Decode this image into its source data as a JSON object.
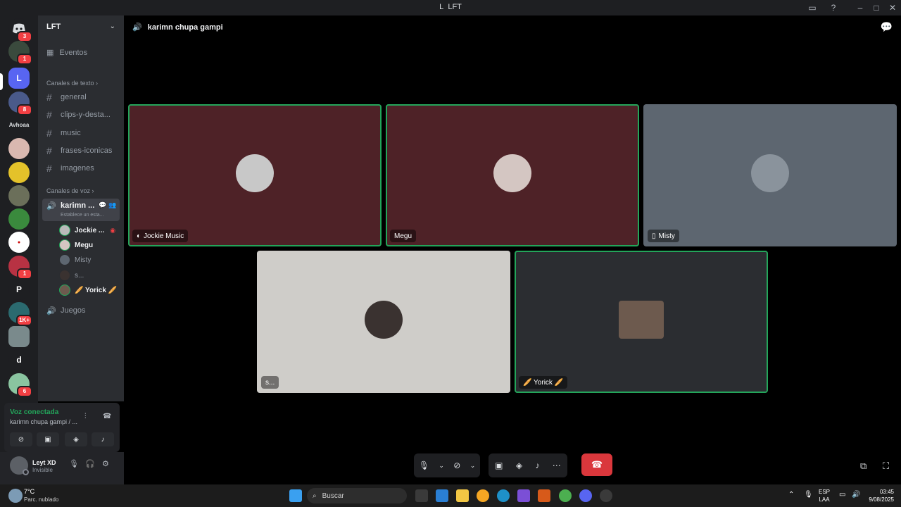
{
  "window": {
    "title": "LFT",
    "title_prefix": "L"
  },
  "guild": {
    "name": "LFT",
    "events_label": "Eventos",
    "text_category": "Canales de texto",
    "text_channels": [
      "general",
      "clips-y-desta...",
      "music",
      "frases-iconicas",
      "imagenes"
    ],
    "voice_category": "Canales de voz",
    "active_voice": {
      "name": "karimn ...",
      "status": "Establece un esta..."
    },
    "voice_users": [
      "Jockie ...",
      "Megu",
      "Misty",
      "s...",
      "🥖 Yorick 🥖"
    ],
    "other_voice": "Juegos"
  },
  "servers": {
    "badges": [
      "3",
      "1",
      "",
      "8",
      "",
      "",
      "",
      "",
      "",
      "",
      "",
      "1",
      "",
      "1K+",
      "",
      "",
      "6"
    ],
    "label_avhoaa": "Avhoaa",
    "letters": {
      "L": "L",
      "P": "P",
      "d": "d"
    }
  },
  "voice_panel": {
    "status": "Voz conectada",
    "subtitle": "karimn chupa gampi / ..."
  },
  "user": {
    "name": "Leyt XD",
    "state": "Invisible"
  },
  "stage": {
    "channel_title": "karimn chupa gampi",
    "tiles": [
      {
        "label": "Jockie Music",
        "bg": "#4e2227",
        "speaking": true,
        "avatar_color": "#c8c8c8"
      },
      {
        "label": "Megu",
        "bg": "#4e2227",
        "speaking": true,
        "avatar_color": "#d4c6c2"
      },
      {
        "label": "Misty",
        "bg": "#5d6670",
        "speaking": false,
        "avatar_color": "#8a939c"
      },
      {
        "label": "s...",
        "bg": "#cfcdc9",
        "speaking": false,
        "avatar_color": "#3a3230"
      },
      {
        "label": "🥖 Yorick 🥖",
        "bg": "#2b2d31",
        "speaking": true,
        "avatar_color": "#6d5a4e"
      }
    ]
  },
  "taskbar": {
    "temperature": "7°C",
    "weather": "Parc. nublado",
    "search_placeholder": "Buscar",
    "lang_1": "ESP",
    "lang_2": "LAA",
    "time": "03:45",
    "date": "9/08/2025"
  },
  "colors": {
    "speaking": "#23a55a",
    "hangup": "#da373c",
    "blurple": "#5865f2"
  }
}
